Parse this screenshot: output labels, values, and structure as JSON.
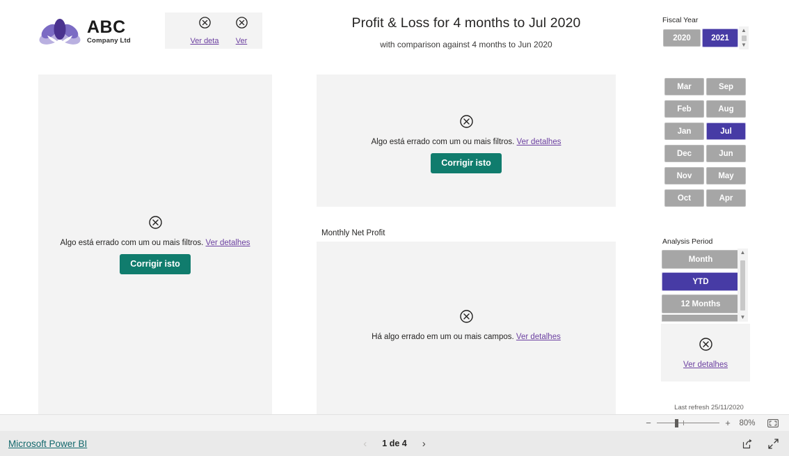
{
  "company": {
    "name": "ABC",
    "subtitle": "Company Ltd",
    "logo_icon": "lotus-flower-logo"
  },
  "header": {
    "title": "Profit & Loss for 4 months to Jul 2020",
    "subtitle": "with comparison against 4 months to Jun 2020"
  },
  "errors": {
    "icon": "error-circle-x-icon",
    "filter_message": "Algo está errado com um ou mais filtros.",
    "fields_message": "Há algo errado em um ou mais campos.",
    "details_link": "Ver detalhes",
    "details_link_truncated": "Ver deta",
    "details_link_clipped": "Ver",
    "fix_button": "Corrigir isto"
  },
  "visuals": {
    "monthly_net_profit_title": "Monthly Net Profit"
  },
  "slicers": {
    "fiscal_year": {
      "label": "Fiscal Year",
      "options": [
        "2020",
        "2021"
      ],
      "selected": "2021"
    },
    "month": {
      "column_left": [
        "Mar",
        "Feb",
        "Jan",
        "Dec",
        "Nov",
        "Oct"
      ],
      "column_right": [
        "Sep",
        "Aug",
        "Jul",
        "Jun",
        "May",
        "Apr"
      ],
      "selected": "Jul"
    },
    "analysis_period": {
      "label": "Analysis Period",
      "options": [
        "Month",
        "YTD",
        "12 Months"
      ],
      "selected": "YTD"
    }
  },
  "footer": {
    "last_refresh": "Last refresh 25/11/2020",
    "powerbi_link": "Microsoft Power BI",
    "page_indicator": "1 de 4",
    "prev_icon": "chevron-left-icon",
    "next_icon": "chevron-right-icon",
    "share_icon": "share-icon",
    "fullscreen_icon": "fullscreen-expand-icon"
  },
  "zoom": {
    "minus": "−",
    "plus": "+",
    "level": "80%",
    "fit_icon": "fit-to-page-icon"
  },
  "colors": {
    "accent_purple": "#473ba5",
    "slicer_gray": "#a6a6a6",
    "fix_button_green": "#107c6d",
    "link_purple": "#6b3fa0",
    "powerbi_teal": "#11676b",
    "panel_bg": "#f3f3f3"
  }
}
